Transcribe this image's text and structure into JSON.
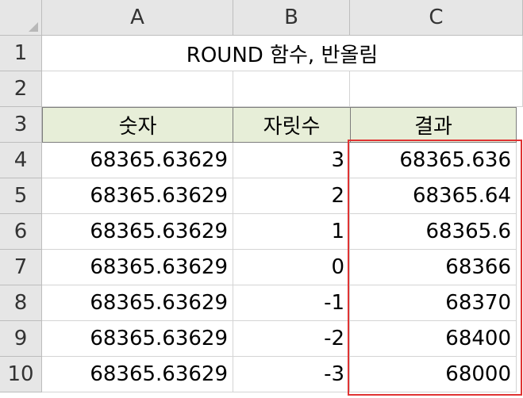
{
  "columns": [
    "A",
    "B",
    "C"
  ],
  "rows": [
    "1",
    "2",
    "3",
    "4",
    "5",
    "6",
    "7",
    "8",
    "9",
    "10"
  ],
  "title": "ROUND 함수, 반올림",
  "headers": {
    "number": "숫자",
    "digits": "자릿수",
    "result": "결과"
  },
  "data": [
    {
      "number": "68365.63629",
      "digits": "3",
      "result": "68365.636"
    },
    {
      "number": "68365.63629",
      "digits": "2",
      "result": "68365.64"
    },
    {
      "number": "68365.63629",
      "digits": "1",
      "result": "68365.6"
    },
    {
      "number": "68365.63629",
      "digits": "0",
      "result": "68366"
    },
    {
      "number": "68365.63629",
      "digits": "-1",
      "result": "68370"
    },
    {
      "number": "68365.63629",
      "digits": "-2",
      "result": "68400"
    },
    {
      "number": "68365.63629",
      "digits": "-3",
      "result": "68000"
    }
  ],
  "colors": {
    "header_fill": "#e7eed8",
    "highlight": "#e03333",
    "grid_header": "#e6e6e6"
  }
}
